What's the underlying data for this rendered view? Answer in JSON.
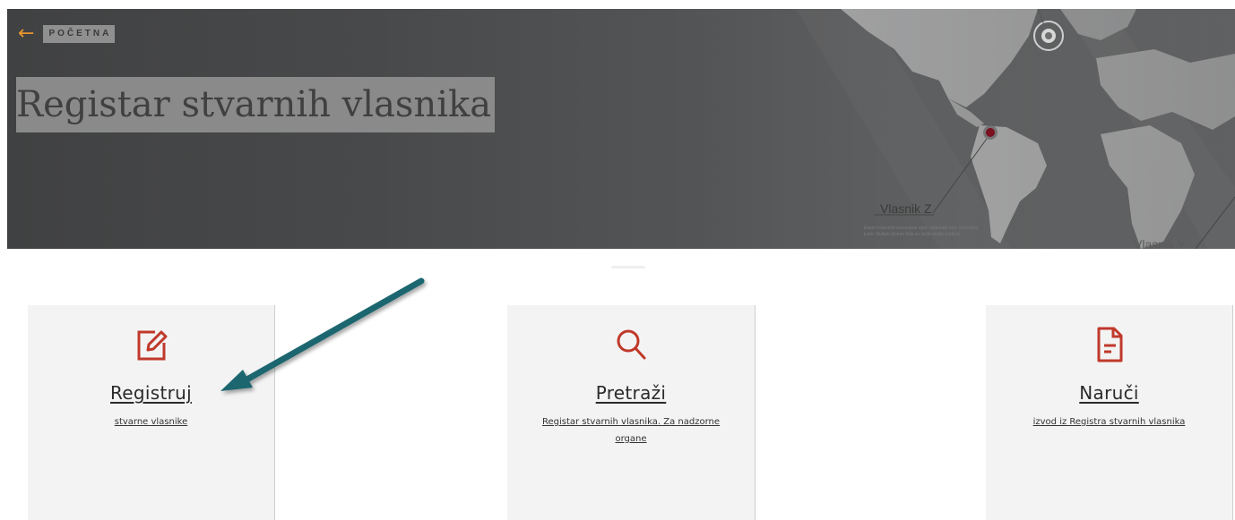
{
  "header": {
    "back_label": "POČETNA",
    "title": "Registar stvarnih vlasnika",
    "map_captions": [
      {
        "title": "Vlasnik Z",
        "text": "Etiam imperdiet consequat eget, vulputate non, venenatis justo. Nullam dictum felis eu pede mollis pretium."
      },
      {
        "title": "Vlasnik Y",
        "text": ""
      }
    ]
  },
  "cards": [
    {
      "title": "Registruj",
      "subtitle": "stvarne vlasnike",
      "icon": "edit-icon"
    },
    {
      "title": "Pretraži",
      "subtitle": "Registar stvarnih vlasnika. Za nadzorne organe",
      "icon": "search-icon"
    },
    {
      "title": "Naruči",
      "subtitle": "izvod iz Registra stvarnih vlasnika",
      "icon": "document-icon"
    }
  ],
  "colors": {
    "accent_red": "#c0392b",
    "back_arrow": "#e8962e",
    "annotation_arrow": "#1f6670",
    "card_bg": "#f3f3f3"
  }
}
